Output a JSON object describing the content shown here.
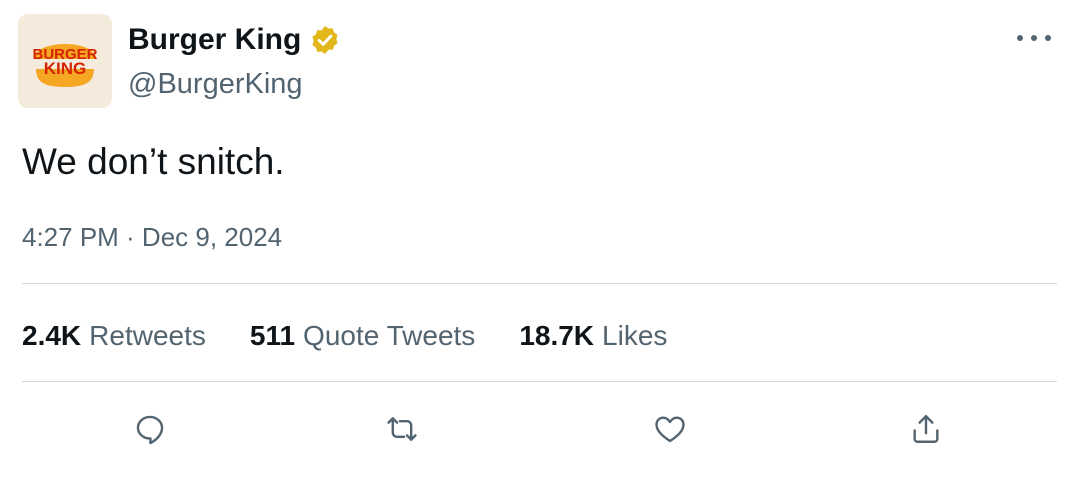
{
  "author": {
    "display_name": "Burger King",
    "handle": "@BurgerKing",
    "verified": true,
    "avatar_logo": {
      "top_text": "BURGER",
      "bottom_text": "KING"
    }
  },
  "tweet": {
    "text": "We don’t snitch.",
    "timestamp": "4:27 PM · Dec 9, 2024"
  },
  "stats": {
    "retweets": {
      "count": "2.4K",
      "label": "Retweets"
    },
    "quote_tweets": {
      "count": "511",
      "label": "Quote Tweets"
    },
    "likes": {
      "count": "18.7K",
      "label": "Likes"
    }
  },
  "actions": {
    "reply": "reply-icon",
    "retweet": "retweet-icon",
    "like": "heart-icon",
    "share": "share-icon"
  },
  "colors": {
    "text_primary": "#0f1419",
    "text_secondary": "#536471",
    "divider": "#cfd9de",
    "verified_badge": "#e2b719",
    "logo_red": "#d62300",
    "logo_bun": "#f5a623",
    "avatar_bg": "#f5ebdc"
  }
}
